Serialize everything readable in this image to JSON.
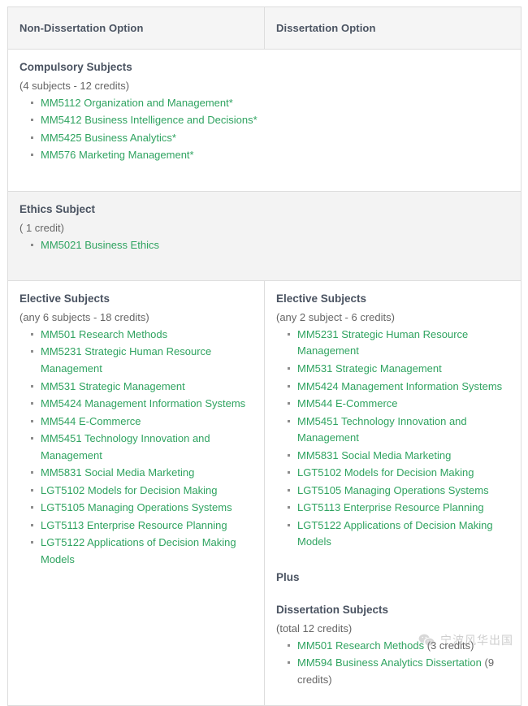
{
  "table": {
    "headers": [
      {
        "label": "Non-Dissertation Option"
      },
      {
        "label": "Dissertation Option"
      }
    ]
  },
  "compulsory": {
    "title": "Compulsory Subjects",
    "subtitle": "(4 subjects - 12 credits)",
    "items": [
      "MM5112 Organization and Management*",
      "MM5412 Business Intelligence and Decisions*",
      "MM5425 Business Analytics*",
      "MM576 Marketing Management*"
    ]
  },
  "ethics": {
    "title": "Ethics Subject",
    "subtitle": "( 1 credit)",
    "items": [
      "MM5021  Business Ethics"
    ]
  },
  "electives_left": {
    "title": "Elective Subjects",
    "subtitle": "(any 6 subjects - 18 credits)",
    "items": [
      "MM501 Research Methods",
      "MM5231 Strategic Human Resource Management",
      "MM531 Strategic Management",
      "MM5424 Management Information Systems",
      "MM544 E-Commerce",
      "MM5451 Technology Innovation and Management",
      "MM5831 Social Media Marketing",
      "LGT5102 Models for Decision Making",
      "LGT5105 Managing Operations Systems",
      "LGT5113 Enterprise Resource Planning",
      "LGT5122 Applications of Decision Making Models"
    ]
  },
  "electives_right": {
    "title": "Elective Subjects",
    "subtitle": "(any 2 subject - 6 credits)",
    "items": [
      "MM5231 Strategic Human Resource Management",
      "MM531 Strategic Management",
      "MM5424 Management Information Systems",
      "MM544 E-Commerce",
      "MM5451 Technology Innovation and Management",
      "MM5831 Social Media Marketing",
      "LGT5102 Models for Decision Making",
      "LGT5105 Managing Operations Systems",
      "LGT5113 Enterprise Resource Planning",
      "LGT5122 Applications of Decision Making Models"
    ]
  },
  "plus": {
    "label": "Plus"
  },
  "dissertation": {
    "title": "Dissertation Subjects",
    "subtitle": "(total 12 credits)",
    "items": [
      {
        "link": "MM501 Research Methods",
        "note": " (3 credits)"
      },
      {
        "link": "MM594 Business Analytics Dissertation",
        "note": " (9 credits)"
      }
    ]
  },
  "watermark": {
    "icon": "wechat-icon",
    "text": "宁波风华出国"
  },
  "colors": {
    "link_green": "#2fa360",
    "header_text": "#4a5361",
    "body_text": "#666666",
    "border": "#dddddd",
    "header_bg": "#f5f5f5",
    "shaded_bg": "#f3f3f3"
  }
}
